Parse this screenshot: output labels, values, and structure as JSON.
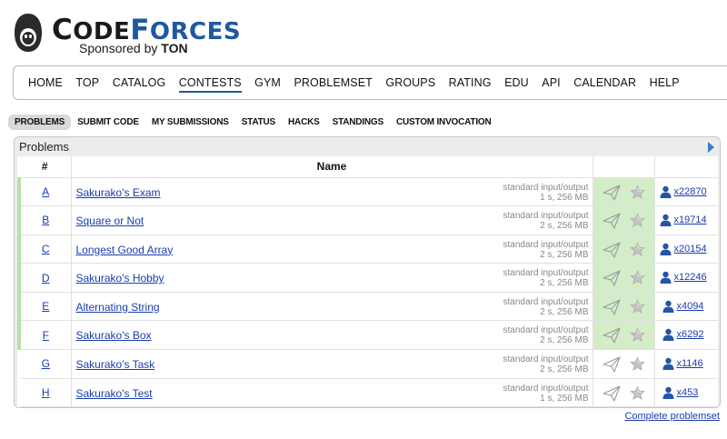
{
  "brand": {
    "name_first": "C",
    "name_code": "ODE",
    "name_forces_first": "F",
    "name_forces": "ORCES",
    "sponsor_prefix": "Sponsored by ",
    "sponsor_name": "TON"
  },
  "menu": {
    "items": [
      "HOME",
      "TOP",
      "CATALOG",
      "CONTESTS",
      "GYM",
      "PROBLEMSET",
      "GROUPS",
      "RATING",
      "EDU",
      "API",
      "CALENDAR",
      "HELP"
    ],
    "active": "CONTESTS"
  },
  "submenu": {
    "items": [
      "PROBLEMS",
      "SUBMIT CODE",
      "MY SUBMISSIONS",
      "STATUS",
      "HACKS",
      "STANDINGS",
      "CUSTOM INVOCATION"
    ],
    "active": "PROBLEMS"
  },
  "problems_box": {
    "title": "Problems",
    "columns": {
      "index": "#",
      "name": "Name"
    },
    "rows": [
      {
        "index": "A",
        "name": "Sakurako's Exam",
        "io": "standard input/output",
        "limits": "1 s, 256 MB",
        "solvers": "x22870",
        "solved": true
      },
      {
        "index": "B",
        "name": "Square or Not",
        "io": "standard input/output",
        "limits": "2 s, 256 MB",
        "solvers": "x19714",
        "solved": true
      },
      {
        "index": "C",
        "name": "Longest Good Array",
        "io": "standard input/output",
        "limits": "2 s, 256 MB",
        "solvers": "x20154",
        "solved": true
      },
      {
        "index": "D",
        "name": "Sakurako's Hobby",
        "io": "standard input/output",
        "limits": "2 s, 256 MB",
        "solvers": "x12246",
        "solved": true
      },
      {
        "index": "E",
        "name": "Alternating String",
        "io": "standard input/output",
        "limits": "2 s, 256 MB",
        "solvers": "x4094",
        "solved": true
      },
      {
        "index": "F",
        "name": "Sakurako's Box",
        "io": "standard input/output",
        "limits": "2 s, 256 MB",
        "solvers": "x6292",
        "solved": true
      },
      {
        "index": "G",
        "name": "Sakurako's Task",
        "io": "standard input/output",
        "limits": "2 s, 256 MB",
        "solvers": "x1146",
        "solved": false
      },
      {
        "index": "H",
        "name": "Sakurako's Test",
        "io": "standard input/output",
        "limits": "1 s, 256 MB",
        "solvers": "x453",
        "solved": false
      }
    ],
    "icons": {
      "submit": "paper-plane-icon",
      "favourite": "star-icon",
      "solvers": "user-icon"
    },
    "colors": {
      "solved_bg": "#d4edc9",
      "solved_border": "#b6e1a5",
      "link": "#1a3db0",
      "accent": "#1f57a4"
    }
  },
  "footer": {
    "complete_link": "Complete problemset"
  }
}
